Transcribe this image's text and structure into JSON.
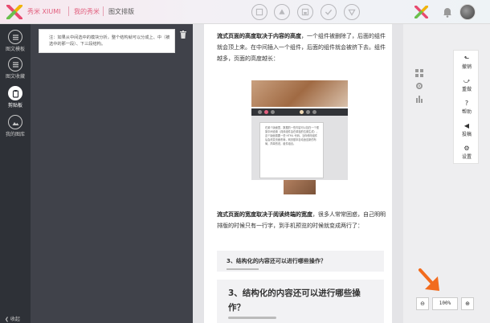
{
  "header": {
    "brand": "秀米 XIUMI",
    "crumbs": [
      "我的秀米",
      "图文排版"
    ]
  },
  "leftnav": {
    "items": [
      {
        "label": "图文模板",
        "icon": "list-icon"
      },
      {
        "label": "图文收藏",
        "icon": "list-icon"
      },
      {
        "label": "剪贴板",
        "icon": "clipboard-icon",
        "active": true
      },
      {
        "label": "我的图库",
        "icon": "image-icon"
      }
    ],
    "collapse": "❮ 收起"
  },
  "clipboard": {
    "card_text": "注：如果从中间选中的模块分析，整个结构就可以分成上、中（被选中的那一段）、下三段结构。"
  },
  "editor": {
    "p1_bold": "流式页面的高度取决于内容的高度",
    "p1_rest": "，一个组件被删除了，后面的组件就会顶上来。在中间插入一个组件，后面的组件就会被挤下去。组件越多，页面的高度越长：",
    "p2_bold": "流式页面的宽度取决于阅读终端的宽度",
    "p2_rest": "，很多人常常困惑，自己明明排版的时候只有一行字，到手机预览的时候就变成两行了：",
    "embed_doc_text": "在某个版面里，数据的一些内容可以挂在一个框架中间设置（具体组件会在单独的位置生成），这个版面需要一些 HTML 代码。当你修改组件后会改变页面布局，网页基本自动适应新的布局，简单的说，组件组合。",
    "q_small": "3、结构化的内容还可以进行哪些操作？",
    "q_big": "3、结构化的内容还可以进行哪些操作？"
  },
  "tools": [
    {
      "glyph": "⬑",
      "label": "撤销"
    },
    {
      "glyph": "⤻",
      "label": "重做"
    },
    {
      "glyph": "?",
      "label": "帮助"
    },
    {
      "glyph": "◀",
      "label": "投稿"
    },
    {
      "glyph": "⚙",
      "label": "设置"
    }
  ],
  "zoom": {
    "minus": "⊖",
    "value": "100%",
    "plus": "⊕"
  },
  "colors": {
    "brand_pink": "#e2607f",
    "nav_dark": "#2e3137",
    "panel_dark": "#40424a",
    "arrow_orange": "#f26b1d"
  }
}
